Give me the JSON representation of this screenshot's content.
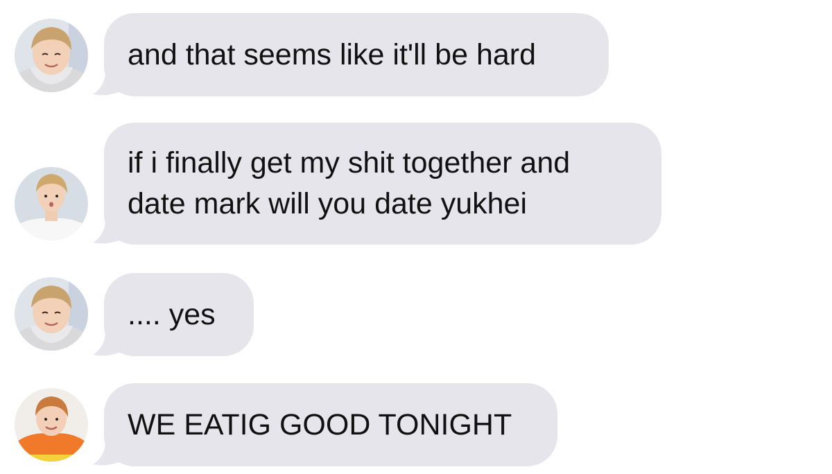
{
  "conversation": {
    "messages": [
      {
        "avatar": "avatar-blond-hoodie",
        "lines": [
          "and that seems like it'll be hard"
        ]
      },
      {
        "avatar": "avatar-blond-white-shirt",
        "lines": [
          "if i finally get my shit together and",
          "date mark will you date yukhei"
        ]
      },
      {
        "avatar": "avatar-blond-hoodie",
        "lines": [
          ".... yes"
        ]
      },
      {
        "avatar": "avatar-orange-hoodie",
        "lines": [
          "WE EATIG GOOD TONIGHT"
        ]
      }
    ]
  },
  "colors": {
    "bubble": "#e6e5eb",
    "text": "#111111",
    "background": "#ffffff"
  }
}
